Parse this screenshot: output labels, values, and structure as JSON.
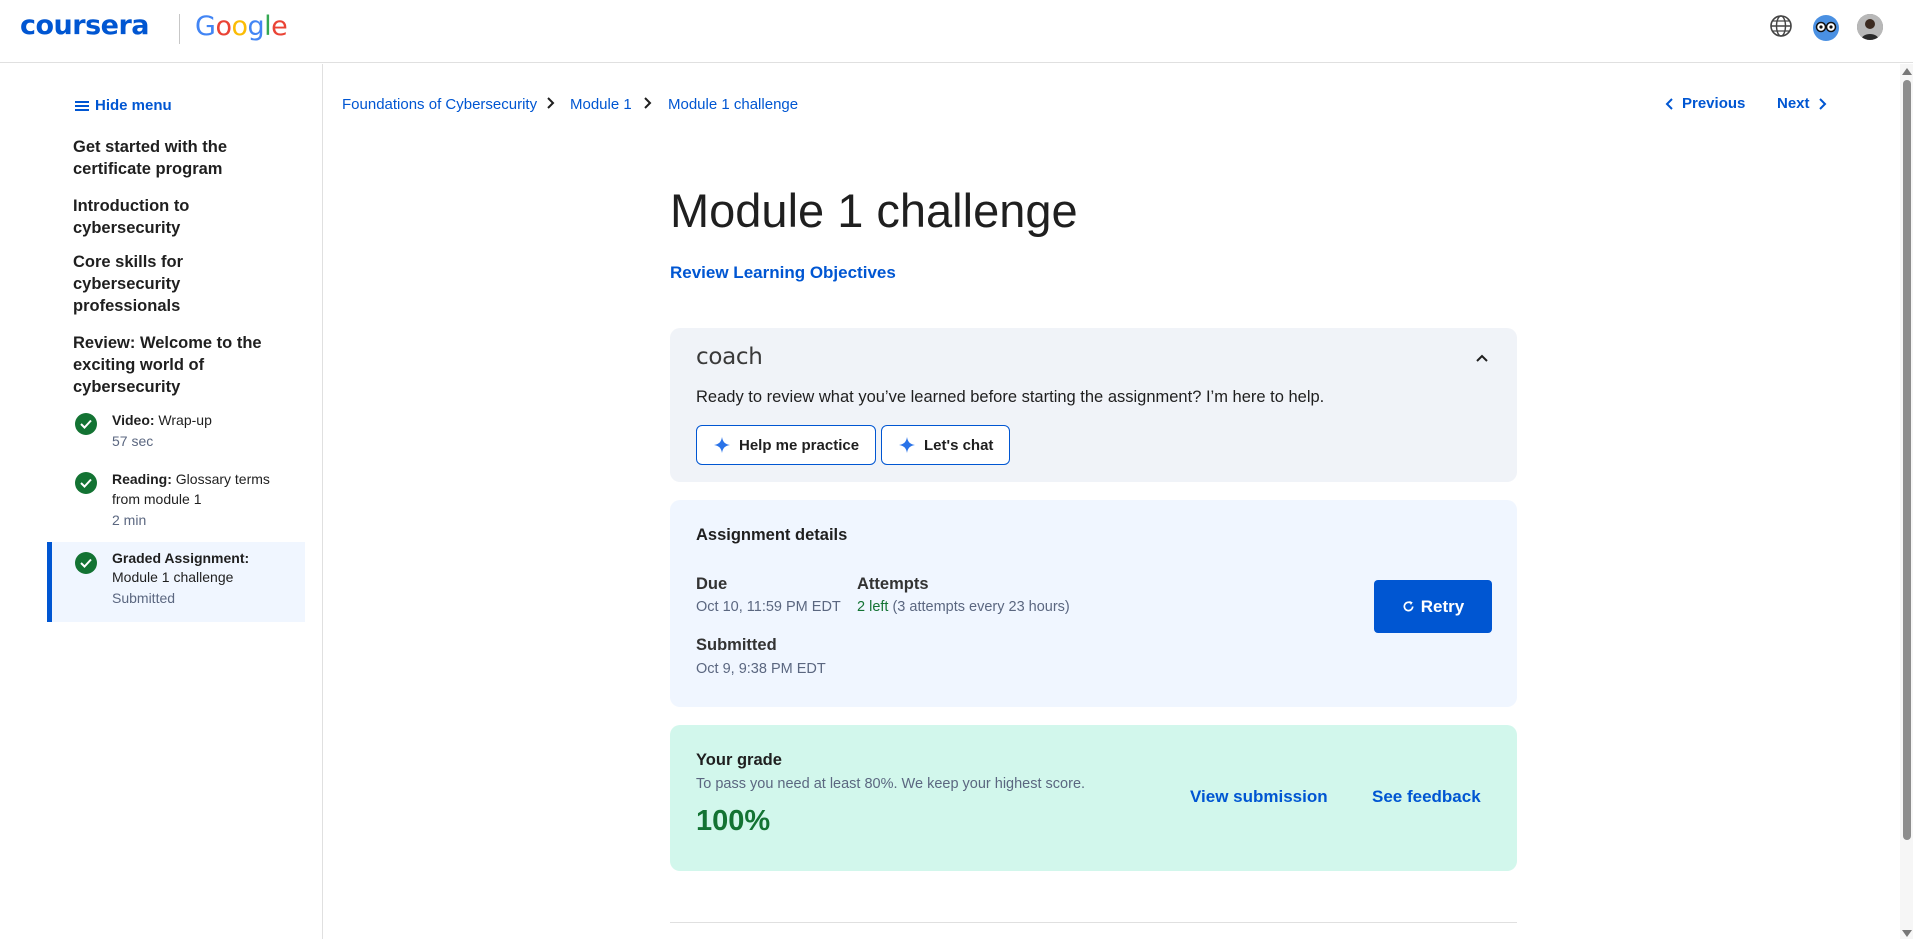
{
  "header": {
    "brand_coursera": "coursera",
    "brand_google_letters": [
      "G",
      "o",
      "o",
      "g",
      "l",
      "e"
    ],
    "icons": [
      "globe-icon",
      "coach-avatar-icon",
      "user-avatar"
    ]
  },
  "sidebar": {
    "hide_menu_label": "Hide menu",
    "modules": [
      "Get started with the certificate program",
      "Introduction to cybersecurity",
      "Core skills for cybersecurity professionals",
      "Review: Welcome to the exciting world of cybersecurity"
    ],
    "items": [
      {
        "type": "Video:",
        "title": "Wrap-up",
        "meta": "57 sec",
        "status": "completed"
      },
      {
        "type": "Reading:",
        "title": "Glossary terms from module 1",
        "meta": "2 min",
        "status": "completed"
      },
      {
        "type": "Graded Assignment:",
        "title": "Module 1 challenge",
        "meta": "Submitted",
        "status": "completed",
        "active": true
      }
    ]
  },
  "breadcrumb": {
    "items": [
      "Foundations of Cybersecurity",
      "Module 1",
      "Module 1 challenge"
    ],
    "separator": ">"
  },
  "nav": {
    "previous": "Previous",
    "next": "Next"
  },
  "main": {
    "title": "Module 1 challenge",
    "review_link": "Review Learning Objectives"
  },
  "coach": {
    "logo": "coach",
    "message": "Ready to review what you’ve learned before starting the assignment? I’m here to help.",
    "btn_practice": "Help me practice",
    "btn_chat": "Let's chat"
  },
  "assignment": {
    "title": "Assignment details",
    "due_label": "Due",
    "due_value": "Oct 10, 11:59 PM EDT",
    "attempts_label": "Attempts",
    "attempts_left": "2 left",
    "attempts_rule": " (3 attempts every 23 hours)",
    "submitted_label": "Submitted",
    "submitted_value": "Oct 9, 9:38 PM EDT",
    "retry_label": "Retry"
  },
  "grade": {
    "title": "Your grade",
    "subtitle": "To pass you need at least 80%. We keep your highest score.",
    "score": "100%",
    "view_submission": "View submission",
    "see_feedback": "See feedback"
  },
  "colors": {
    "brand_blue": "#0056d2",
    "success_green": "#137333",
    "grade_bg": "#d2f7ec",
    "assignment_bg": "#f0f6ff",
    "coach_bg": "#f0f3f8"
  }
}
